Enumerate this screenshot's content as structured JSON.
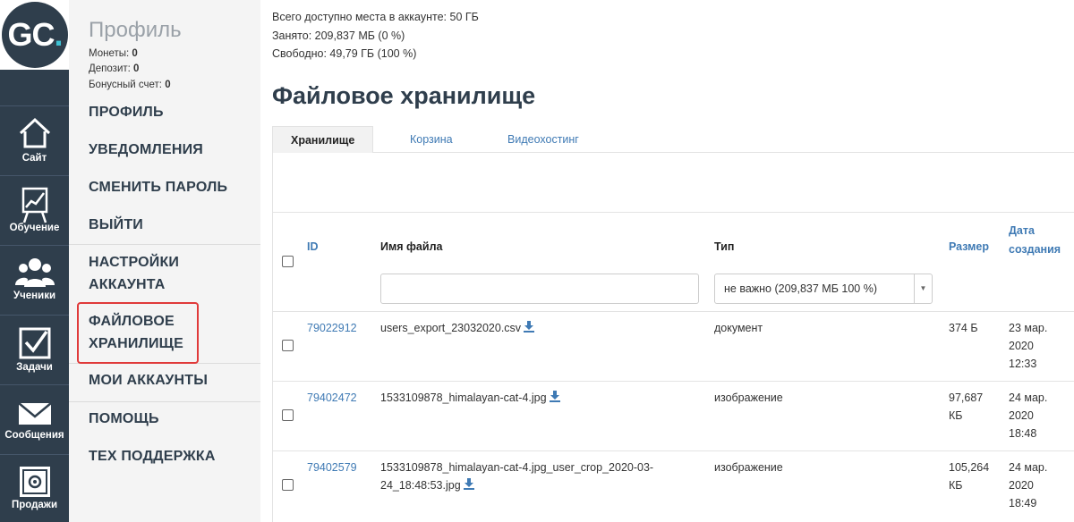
{
  "logo": {
    "text": "GC",
    "dot": "."
  },
  "rail": [
    {
      "label": "Сайт"
    },
    {
      "label": "Обучение"
    },
    {
      "label": "Ученики"
    },
    {
      "label": "Задачи"
    },
    {
      "label": "Сообщения"
    },
    {
      "label": "Продажи"
    }
  ],
  "profile": {
    "title": "Профиль",
    "coins_label": "Монеты:",
    "coins_value": "0",
    "deposit_label": "Депозит:",
    "deposit_value": "0",
    "bonus_label": "Бонусный счет:",
    "bonus_value": "0"
  },
  "menu": {
    "profile": "ПРОФИЛЬ",
    "notifications": "УВЕДОМЛЕНИЯ",
    "change_password": "СМЕНИТЬ ПАРОЛЬ",
    "logout": "ВЫЙТИ",
    "account_settings_1": "НАСТРОЙКИ",
    "account_settings_2": "АККАУНТА",
    "file_storage_1": "ФАЙЛОВОЕ",
    "file_storage_2": "ХРАНИЛИЩЕ",
    "my_accounts": "МОИ АККАУНТЫ",
    "help": "ПОМОЩЬ",
    "support": "ТЕХ ПОДДЕРЖКА"
  },
  "storage_info": {
    "total": "Всего доступно места в аккаунте: 50 ГБ",
    "used": "Занято: 209,837 МБ (0 %)",
    "free": "Свободно: 49,79 ГБ (100 %)"
  },
  "page_title": "Файловое хранилище",
  "tabs": [
    "Хранилище",
    "Корзина",
    "Видеохостинг"
  ],
  "table": {
    "headers": {
      "id": "ID",
      "name": "Имя файла",
      "type": "Тип",
      "size": "Размер",
      "date_1": "Дата",
      "date_2": "создания"
    },
    "filter_name_value": "",
    "filter_type_value": "не важно (209,837 МБ 100 %)",
    "rows": [
      {
        "id": "79022912",
        "name_1": "users_export_23032020.csv",
        "name_2": "",
        "type": "документ",
        "size_1": "374 Б",
        "size_2": "",
        "date_1": "23 мар.",
        "date_2": "2020",
        "date_3": "12:33"
      },
      {
        "id": "79402472",
        "name_1": "1533109878_himalayan-cat-4.jpg",
        "name_2": "",
        "type": "изображение",
        "size_1": "97,687",
        "size_2": "КБ",
        "date_1": "24 мар.",
        "date_2": "2020",
        "date_3": "18:48"
      },
      {
        "id": "79402579",
        "name_1": "1533109878_himalayan-cat-4.jpg_user_crop_2020-03-",
        "name_2": "24_18:48:53.jpg",
        "type": "изображение",
        "size_1": "105,264",
        "size_2": "КБ",
        "date_1": "24 мар.",
        "date_2": "2020",
        "date_3": "18:49"
      }
    ]
  },
  "colors": {
    "rail": "#2f3e4c",
    "link": "#3f7ab4",
    "highlight": "#e03a3a",
    "logo_dot": "#3ec1d3"
  },
  "icons": [
    "home-icon",
    "chart-board-icon",
    "users-icon",
    "checkbox-icon",
    "envelope-icon",
    "safe-icon",
    "download-icon",
    "chevron-down-icon"
  ]
}
